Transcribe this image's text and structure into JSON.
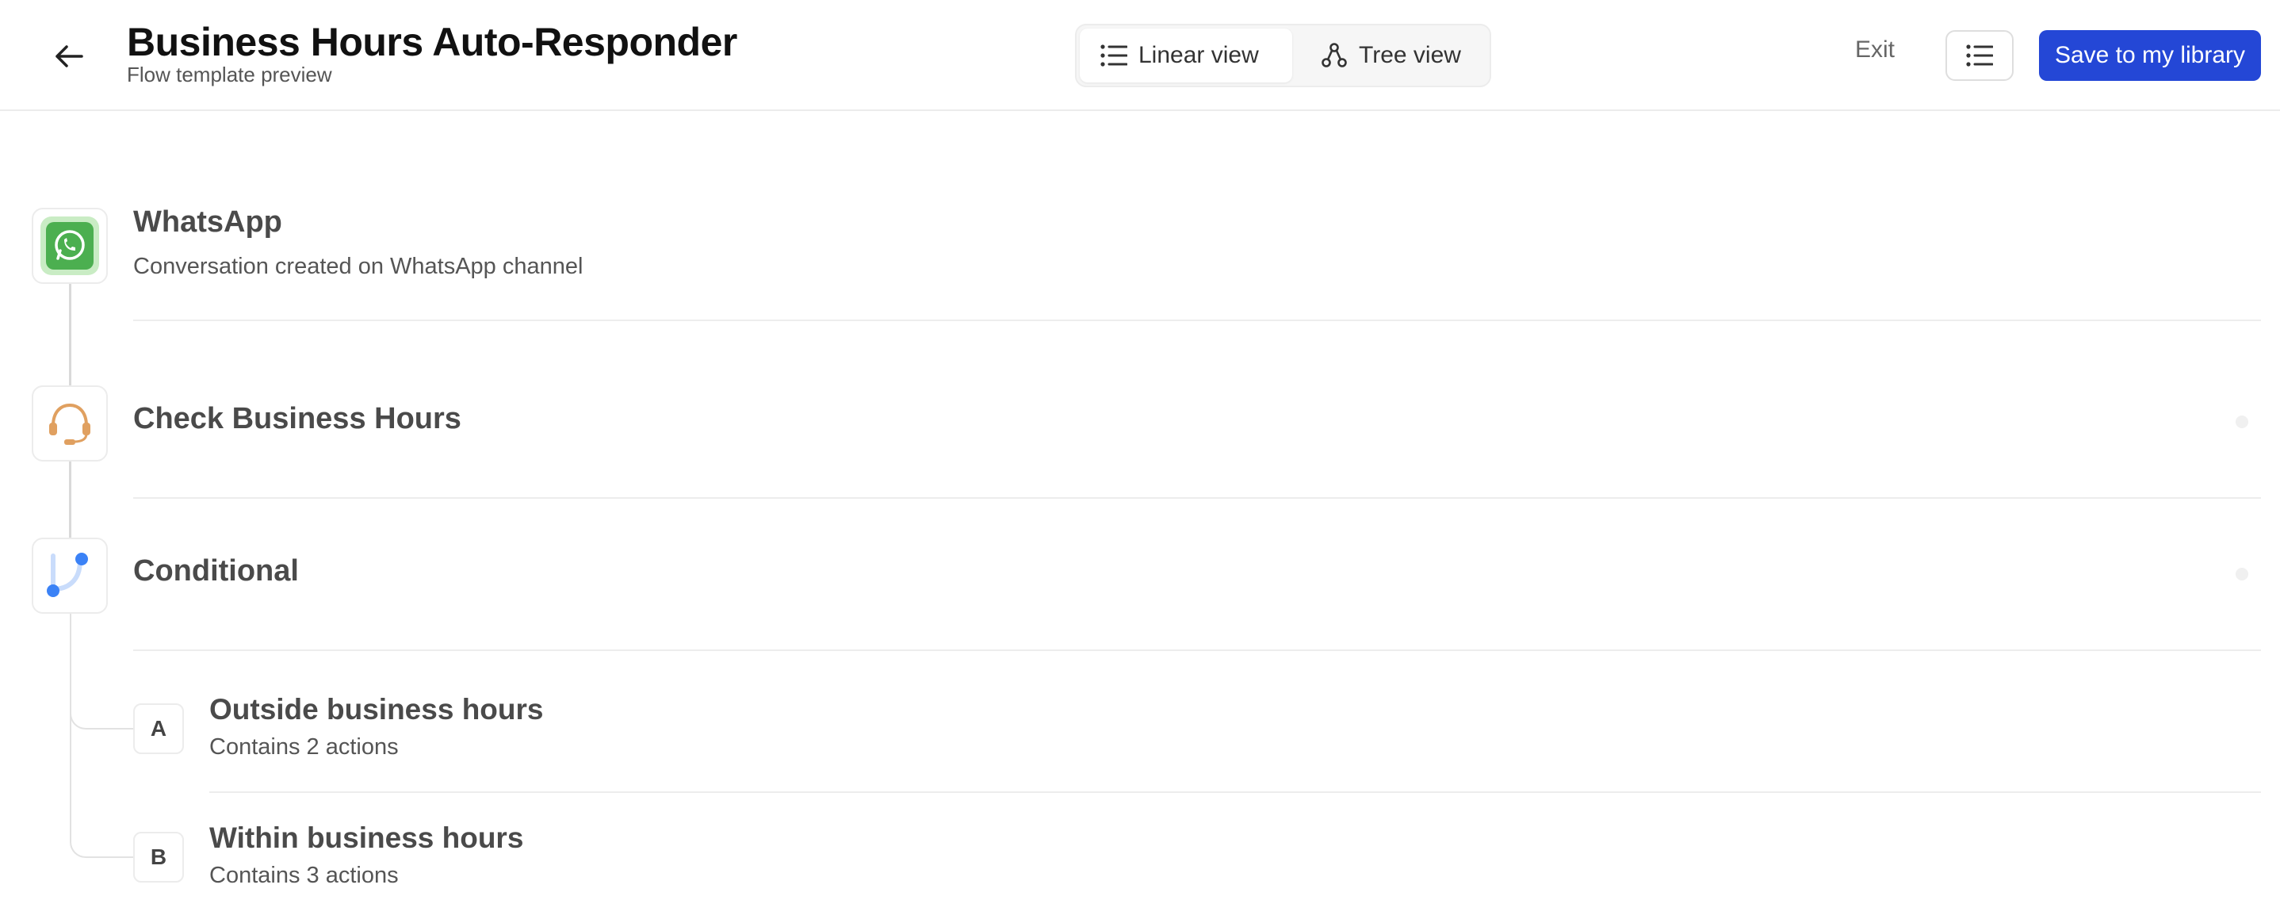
{
  "header": {
    "title": "Business Hours Auto-Responder",
    "subtitle": "Flow template preview",
    "view_toggle": {
      "linear_label": "Linear view",
      "tree_label": "Tree view",
      "selected": "Linear view"
    },
    "exit_label": "Exit",
    "save_label": "Save to my library"
  },
  "flow": {
    "trigger": {
      "title": "WhatsApp",
      "description": "Conversation created on WhatsApp channel",
      "icon": "whatsapp-icon"
    },
    "step_business_hours": {
      "title": "Check Business Hours",
      "icon": "headset-icon"
    },
    "step_conditional": {
      "title": "Conditional",
      "icon": "branch-icon"
    },
    "branches": [
      {
        "badge": "A",
        "title": "Outside business hours",
        "description": "Contains 2 actions"
      },
      {
        "badge": "B",
        "title": "Within business hours",
        "description": "Contains 3 actions"
      }
    ]
  },
  "colors": {
    "primary": "#2447d6",
    "whatsapp_green": "#4caf50",
    "headset_orange": "#e0a060",
    "branch_blue": "#3b82f6"
  }
}
